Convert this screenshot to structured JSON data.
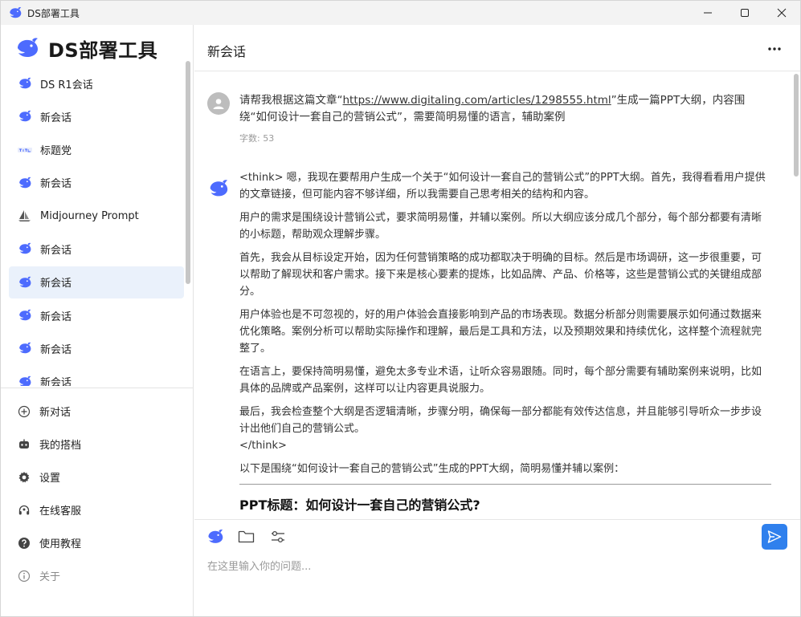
{
  "window": {
    "title": "DS部署工具",
    "controls": [
      "minimize-icon",
      "maximize-icon",
      "close-icon"
    ]
  },
  "sidebar": {
    "brand": "DS部署工具",
    "items": [
      {
        "label": "DS R1会话",
        "icon": "whale-icon",
        "active": false
      },
      {
        "label": "新会话",
        "icon": "whale-icon",
        "active": false
      },
      {
        "label": "标题党",
        "icon": "title-icon",
        "active": false
      },
      {
        "label": "新会话",
        "icon": "whale-icon",
        "active": false
      },
      {
        "label": "Midjourney Prompt",
        "icon": "sail-icon",
        "active": false
      },
      {
        "label": "新会话",
        "icon": "whale-icon",
        "active": false
      },
      {
        "label": "新会话",
        "icon": "whale-icon",
        "active": true
      },
      {
        "label": "新会话",
        "icon": "whale-icon",
        "active": false
      },
      {
        "label": "新会话",
        "icon": "whale-icon",
        "active": false
      },
      {
        "label": "新会话",
        "icon": "whale-icon",
        "active": false
      }
    ],
    "menu": [
      {
        "label": "新对话",
        "icon": "plus-circle-icon"
      },
      {
        "label": "我的搭档",
        "icon": "robot-icon"
      },
      {
        "label": "设置",
        "icon": "gear-icon"
      },
      {
        "label": "在线客服",
        "icon": "headset-icon"
      },
      {
        "label": "使用教程",
        "icon": "help-icon"
      },
      {
        "label": "关于",
        "icon": "info-icon"
      }
    ]
  },
  "main": {
    "title": "新会话",
    "more_icon": "more-horizontal-icon"
  },
  "chat": {
    "user_message": {
      "prefix": "请帮我根据这篇文章“",
      "link": "https://www.digitaling.com/articles/1298555.html",
      "suffix": "”生成一篇PPT大纲，内容围绕“如何设计一套自己的营销公式”，需要简明易懂的语言，辅助案例",
      "char_count": "字数: 53"
    },
    "assistant": {
      "paragraphs": [
        "<think> 嗯，我现在要帮用户生成一个关于“如何设计一套自己的营销公式”的PPT大纲。首先，我得看看用户提供的文章链接，但可能内容不够详细，所以我需要自己思考相关的结构和内容。",
        "用户的需求是围绕设计营销公式，要求简明易懂，并辅以案例。所以大纲应该分成几个部分，每个部分都要有清晰的小标题，帮助观众理解步骤。",
        "首先，我会从目标设定开始，因为任何营销策略的成功都取决于明确的目标。然后是市场调研，这一步很重要，可以帮助了解现状和客户需求。接下来是核心要素的提炼，比如品牌、产品、价格等，这些是营销公式的关键组成部分。",
        "用户体验也是不可忽视的，好的用户体验会直接影响到产品的市场表现。数据分析部分则需要展示如何通过数据来优化策略。案例分析可以帮助实际操作和理解，最后是工具和方法，以及预期效果和持续优化，这样整个流程就完整了。",
        "在语言上，要保持简明易懂，避免太多专业术语，让听众容易跟随。同时，每个部分需要有辅助案例来说明，比如具体的品牌或产品案例，这样可以让内容更具说服力。"
      ],
      "last_paragraph": "最后，我会检查整个大纲是否逻辑清晰，步骤分明，确保每一部分都能有效传达信息，并且能够引导听众一步步设计出他们自己的营销公式。",
      "think_close": "</think>",
      "intro": "以下是围绕“如何设计一套自己的营销公式”生成的PPT大纲，简明易懂并辅以案例：",
      "heading": "PPT标题：如何设计一套自己的营销公式?"
    }
  },
  "composer": {
    "placeholder": "在这里输入你的问题...",
    "tools": [
      "whale-icon",
      "folder-icon",
      "sliders-icon"
    ],
    "send_icon": "send-icon"
  },
  "colors": {
    "accent": "#2f80ed",
    "brand_blue": "#4d6bfe",
    "active_bg": "#eaf1fb"
  }
}
